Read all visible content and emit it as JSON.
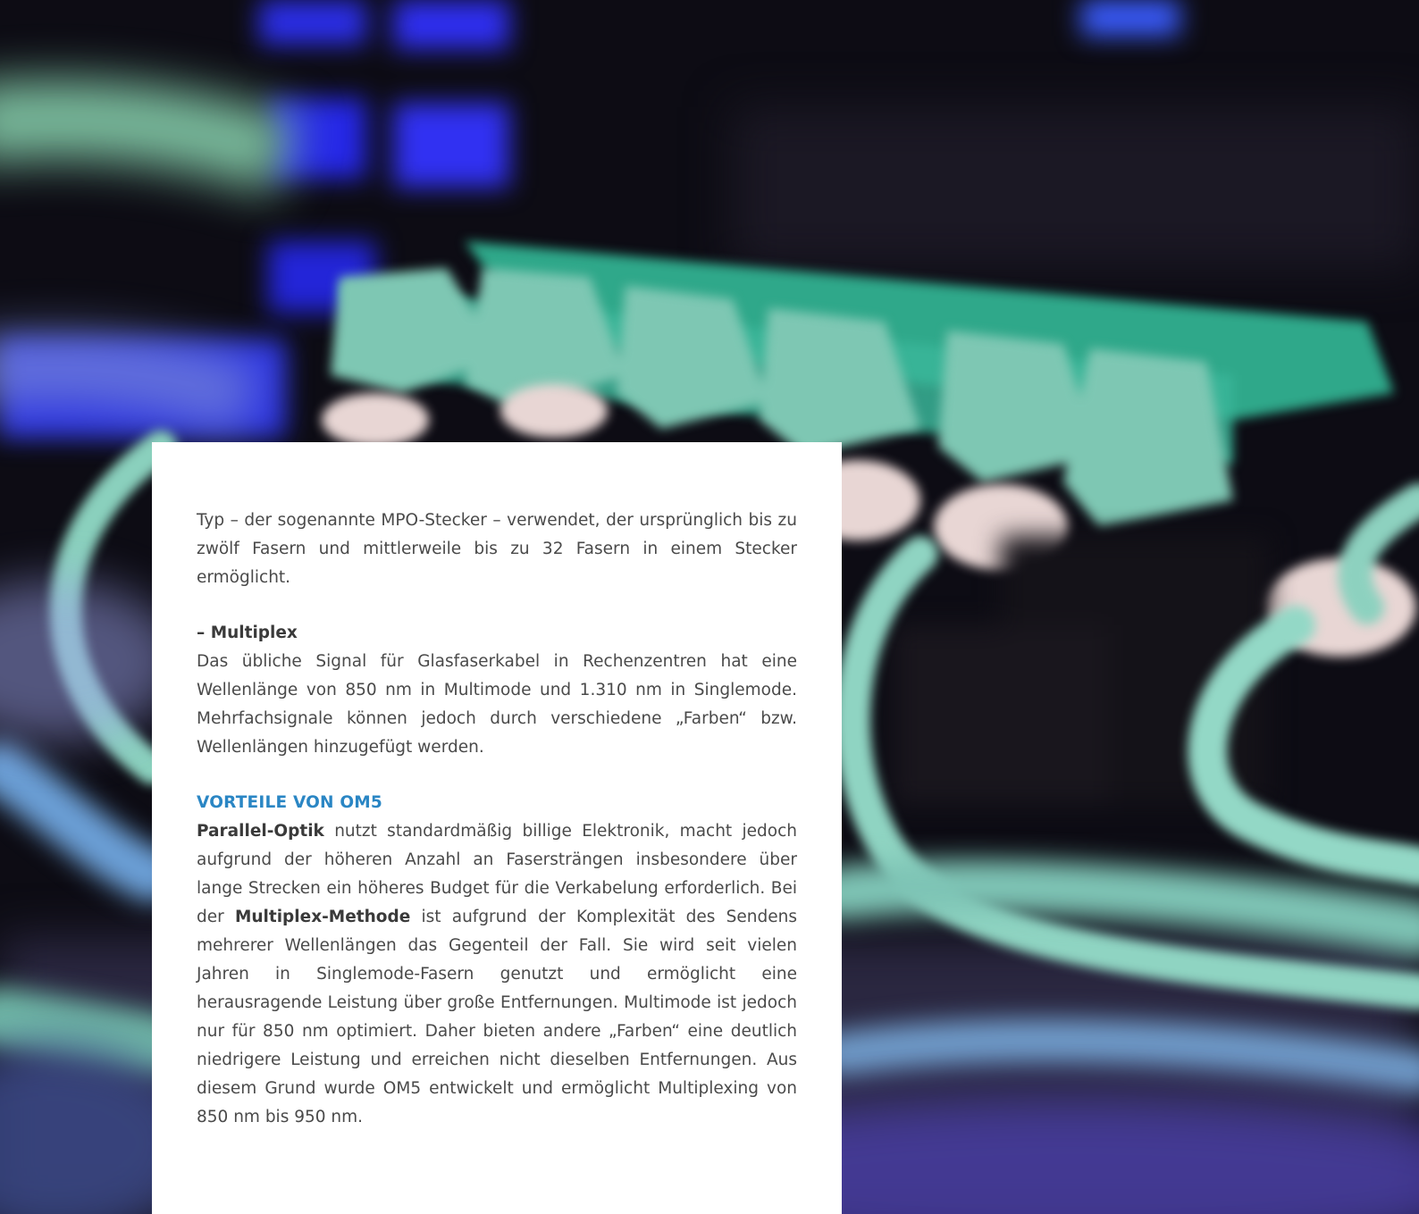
{
  "colors": {
    "heading_accent": "#2a86c4",
    "body_text": "#4a4a4a",
    "card_background": "#ffffff",
    "cable_teal": "#7fc7b6",
    "panel_blue": "#2a2ef0"
  },
  "article": {
    "intro_paragraph": "Typ – der sogenannte MPO-Stecker – verwendet, der ursprünglich bis zu zwölf Fasern und mittlerweile bis zu 32 Fasern in einem Stecker ermöglicht.",
    "multiplex": {
      "heading": "– Multiplex",
      "text": "Das übliche Signal für Glasfaserkabel in Rechenzentren hat eine Wellenlänge von 850 nm in Multimode und 1.310 nm in Singlemode. Mehrfachsignale können jedoch durch verschiedene „Farben“ bzw. Wellenlängen hinzugefügt werden."
    },
    "advantages": {
      "heading": "VORTEILE VON OM5",
      "term_parallel": "Parallel-Optik",
      "text_part1": " nutzt standardmäßig billige Elektronik, macht jedoch aufgrund der höheren Anzahl an Fasersträngen insbesondere über lange Strecken ein höheres Budget für die Verkabelung erforderlich. Bei der ",
      "term_multiplex": "Multiplex-Methode",
      "text_part2": " ist aufgrund der Komplexität des Sendens mehrerer Wellenlängen das Gegenteil der Fall. Sie wird seit vielen Jahren in Singlemode-Fasern genutzt und ermöglicht eine herausragende Leistung über große Entfernungen. Multimode ist jedoch nur für 850 nm optimiert. Daher bieten andere „Farben“ eine deutlich niedrigere Leistung und erreichen nicht dieselben Entfernungen. Aus diesem Grund wurde OM5 entwickelt und ermöglicht Multiplexing von 850 nm bis 950 nm."
    }
  }
}
